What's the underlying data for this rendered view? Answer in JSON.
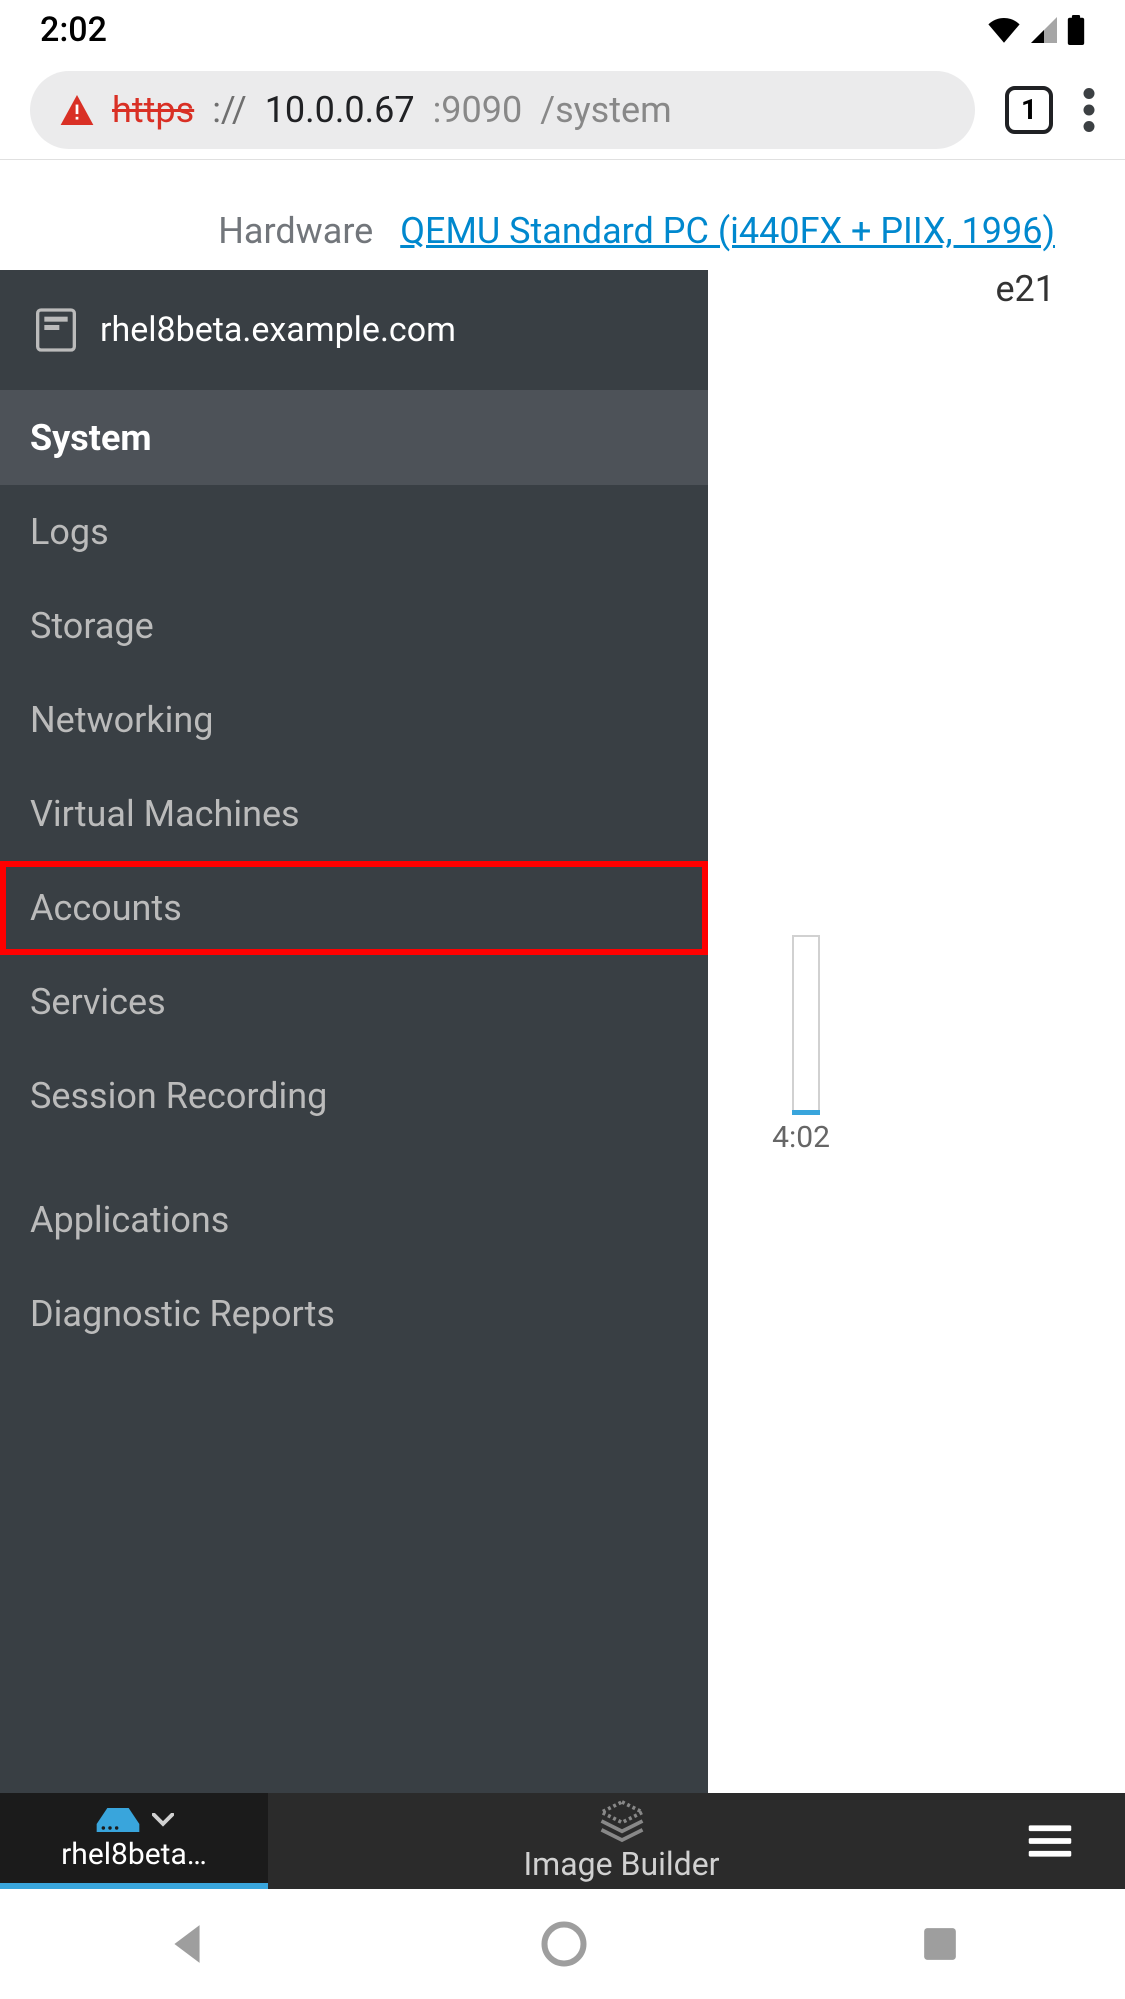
{
  "status": {
    "time": "2:02"
  },
  "browser": {
    "scheme": "https",
    "sep": "://",
    "host": "10.0.0.67",
    "port": ":9090",
    "path": "/system",
    "tab_count": "1"
  },
  "page": {
    "hardware_label": "Hardware",
    "hardware_value": "QEMU Standard PC (i440FX + PIIX, 1996)",
    "partial_text": "e21",
    "chart_time": "4:02"
  },
  "sidebar": {
    "host": "rhel8beta.example.com",
    "items": [
      {
        "label": "System",
        "active": true,
        "highlight": false
      },
      {
        "label": "Logs",
        "active": false,
        "highlight": false
      },
      {
        "label": "Storage",
        "active": false,
        "highlight": false
      },
      {
        "label": "Networking",
        "active": false,
        "highlight": false
      },
      {
        "label": "Virtual Machines",
        "active": false,
        "highlight": false
      },
      {
        "label": "Accounts",
        "active": false,
        "highlight": true
      },
      {
        "label": "Services",
        "active": false,
        "highlight": false
      },
      {
        "label": "Session Recording",
        "active": false,
        "highlight": false
      }
    ],
    "items2": [
      {
        "label": "Applications",
        "active": false,
        "highlight": false
      },
      {
        "label": "Diagnostic Reports",
        "active": false,
        "highlight": false
      }
    ]
  },
  "bottom": {
    "left_label": "rhel8beta…",
    "mid_label": "Image Builder"
  },
  "colors": {
    "accent": "#39a5dc",
    "link": "#0088ce",
    "sidebar_bg": "#393f44",
    "sidebar_active": "#4d5258",
    "highlight": "#ff0000"
  }
}
